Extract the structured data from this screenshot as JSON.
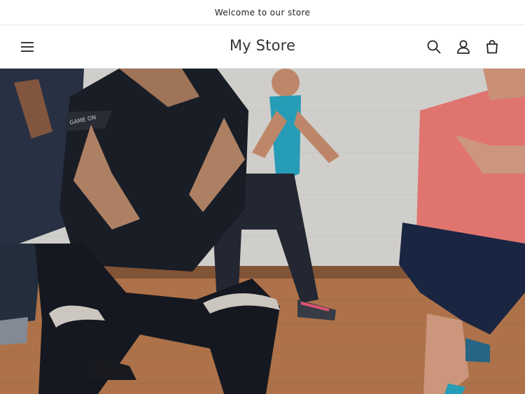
{
  "announcement": {
    "text": "Welcome to our store"
  },
  "header": {
    "store_name": "My Store",
    "icons": {
      "menu": "hamburger-menu-icon",
      "search": "search-icon",
      "account": "account-icon",
      "cart": "cart-icon"
    }
  },
  "hero": {
    "image": "fitness-class-squats-photo",
    "colors": {
      "wall": "#dcdad6",
      "floor": "#b9794a",
      "shirt_pink": "#f07e7a",
      "dark_outfit": "#1f2430",
      "leggings_navy": "#1e2a48"
    }
  }
}
